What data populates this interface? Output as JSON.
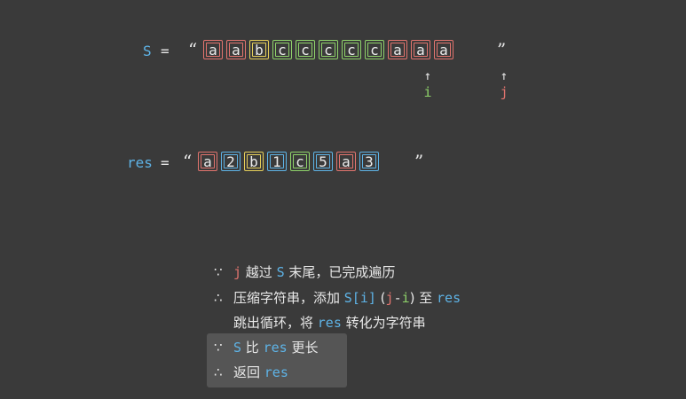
{
  "s_row": {
    "label": "S",
    "equals": "=",
    "open_quote": "“",
    "close_quote": "”",
    "chars": [
      {
        "ch": "a",
        "color": "#e2746e"
      },
      {
        "ch": "a",
        "color": "#e2746e"
      },
      {
        "ch": "b",
        "color": "#e6cf5a"
      },
      {
        "ch": "c",
        "color": "#8fd36a"
      },
      {
        "ch": "c",
        "color": "#8fd36a"
      },
      {
        "ch": "c",
        "color": "#8fd36a"
      },
      {
        "ch": "c",
        "color": "#8fd36a"
      },
      {
        "ch": "c",
        "color": "#8fd36a"
      },
      {
        "ch": "a",
        "color": "#e2746e"
      },
      {
        "ch": "a",
        "color": "#e2746e"
      },
      {
        "ch": "a",
        "color": "#e2746e"
      }
    ]
  },
  "pointers": {
    "i": {
      "arrow": "↑",
      "name": "i"
    },
    "j": {
      "arrow": "↑",
      "name": "j"
    }
  },
  "res_row": {
    "label": "res",
    "equals": "=",
    "open_quote": "“",
    "close_quote": "”",
    "chars": [
      {
        "ch": "a",
        "color": "#e2746e"
      },
      {
        "ch": "2",
        "color": "#5eb3e6"
      },
      {
        "ch": "b",
        "color": "#e6cf5a"
      },
      {
        "ch": "1",
        "color": "#5eb3e6"
      },
      {
        "ch": "c",
        "color": "#8fd36a"
      },
      {
        "ch": "5",
        "color": "#5eb3e6"
      },
      {
        "ch": "a",
        "color": "#e2746e"
      },
      {
        "ch": "3",
        "color": "#5eb3e6"
      }
    ]
  },
  "explanation": {
    "line1": {
      "sym": "∵",
      "j": "j",
      "t1": " 越过 ",
      "s": "S",
      "t2": " 末尾，已完成遍历"
    },
    "line2": {
      "sym": "∴",
      "t1": "压缩字符串，添加 ",
      "si": "S[i]",
      "p1": " (",
      "j": "j",
      "minus": "-",
      "i": "i",
      "p2": ") ",
      "t2": "至 ",
      "res": "res"
    },
    "line3": {
      "t1": "跳出循环，将 ",
      "res": "res",
      "t2": " 转化为字符串"
    },
    "line4": {
      "sym": "∵",
      "s": "S",
      "t1": " 比 ",
      "res": "res",
      "t2": " 更长"
    },
    "line5": {
      "sym": "∴",
      "t1": "返回 ",
      "res": "res"
    }
  }
}
